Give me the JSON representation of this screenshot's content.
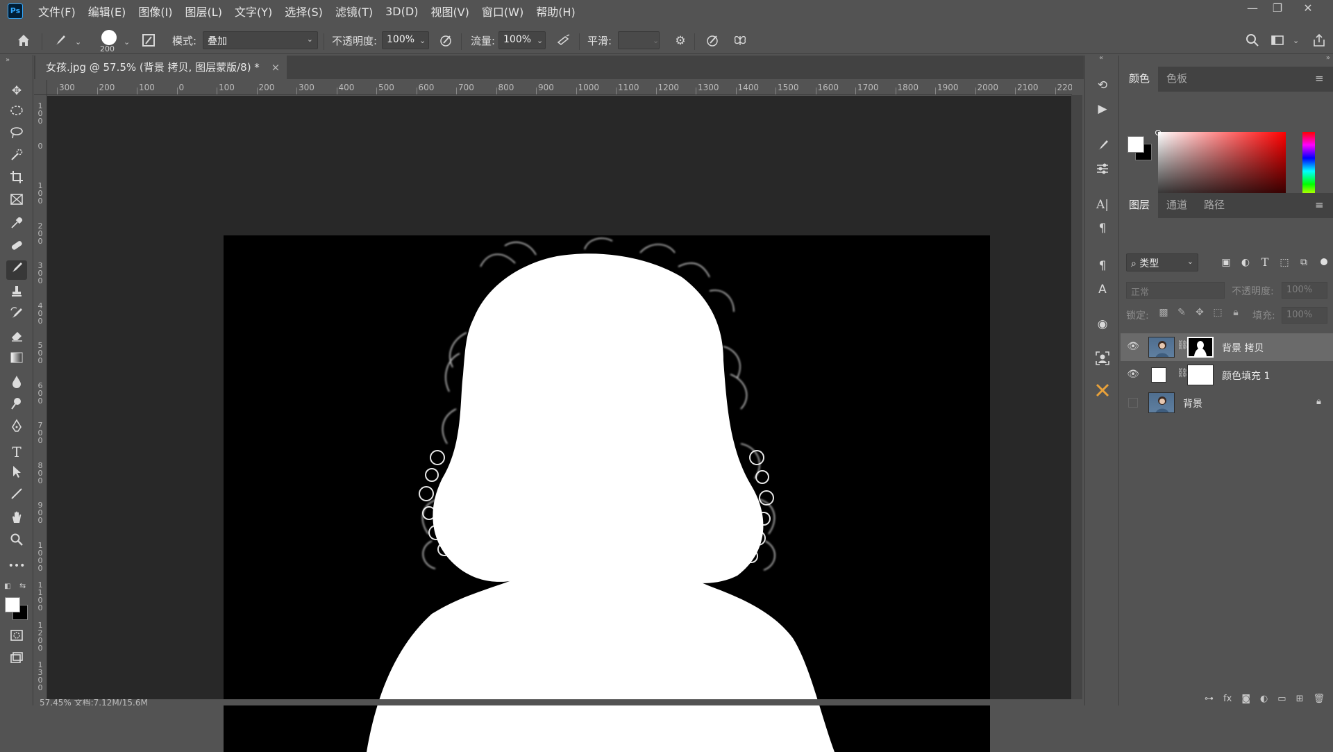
{
  "app": {
    "logo": "Ps",
    "menu": [
      "文件(F)",
      "编辑(E)",
      "图像(I)",
      "图层(L)",
      "文字(Y)",
      "选择(S)",
      "滤镜(T)",
      "3D(D)",
      "视图(V)",
      "窗口(W)",
      "帮助(H)"
    ],
    "window_controls": {
      "minimize": "—",
      "restore": "❐",
      "close": "✕"
    }
  },
  "options_bar": {
    "brush_size": "200",
    "mode_label": "模式:",
    "mode_value": "叠加",
    "opacity_label": "不透明度:",
    "opacity_value": "100%",
    "flow_label": "流量:",
    "flow_value": "100%",
    "smoothing_label": "平滑:",
    "smoothing_value": ""
  },
  "document": {
    "tab_title": "女孩.jpg @ 57.5% (背景 拷贝, 图层蒙版/8) *",
    "close": "×",
    "ruler_top": [
      "300",
      "200",
      "100",
      "0",
      "100",
      "200",
      "300",
      "400",
      "500",
      "600",
      "700",
      "800",
      "900",
      "1000",
      "1100",
      "1200",
      "1300",
      "1400",
      "1500",
      "1600",
      "1700",
      "1800",
      "1900",
      "2000",
      "2100",
      "220"
    ],
    "ruler_left": [
      "100",
      "0",
      "100",
      "200",
      "300",
      "400",
      "500",
      "600",
      "700",
      "800",
      "900",
      "1000",
      "1100",
      "1200",
      "1300"
    ],
    "status": "57.45%        文档:7.12M/15.6M"
  },
  "panels": {
    "color_tabs": [
      "颜色",
      "色板"
    ],
    "layers_tabs": [
      "图层",
      "通道",
      "路径"
    ],
    "filter_label": "类型",
    "blend_mode": "正常",
    "opacity_label": "不透明度:",
    "opacity_value": "100%",
    "lock_label": "锁定:",
    "fill_label": "填充:",
    "fill_value": "100%",
    "layers": [
      {
        "name": "背景 拷贝",
        "visible": true,
        "selected": true,
        "has_mask": true
      },
      {
        "name": "颜色填充 1",
        "visible": true,
        "selected": false,
        "has_mask": true
      },
      {
        "name": "背景",
        "visible": false,
        "selected": false,
        "locked": true
      }
    ]
  },
  "colors": {
    "foreground": "#ffffff",
    "background": "#000000",
    "ps_accent": "#31a8ff"
  }
}
